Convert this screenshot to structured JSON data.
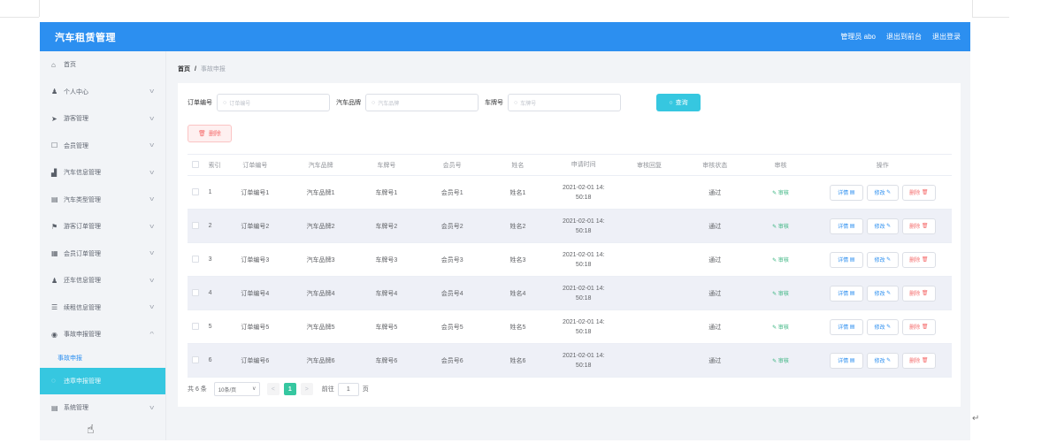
{
  "header": {
    "title": "汽车租赁管理",
    "admin": "管理员 abo",
    "back_to_front": "退出到前台",
    "logout": "退出登录"
  },
  "sidebar": {
    "items": [
      {
        "label": "首页",
        "icon": "home-icon",
        "arrow": false
      },
      {
        "label": "个人中心",
        "icon": "user-icon",
        "arrow": true
      },
      {
        "label": "游客管理",
        "icon": "send-icon",
        "arrow": true
      },
      {
        "label": "会员管理",
        "icon": "inbox-icon",
        "arrow": true
      },
      {
        "label": "汽车信息管理",
        "icon": "chart-icon",
        "arrow": true
      },
      {
        "label": "汽车类型管理",
        "icon": "list-icon",
        "arrow": true
      },
      {
        "label": "游客订单管理",
        "icon": "flag-icon",
        "arrow": true
      },
      {
        "label": "会员订单管理",
        "icon": "document-icon",
        "arrow": true
      },
      {
        "label": "还车信息管理",
        "icon": "user-icon",
        "arrow": true
      },
      {
        "label": "续租信息管理",
        "icon": "menu-icon",
        "arrow": true
      },
      {
        "label": "事故申报管理",
        "icon": "location-icon",
        "arrow": true,
        "expanded": true
      }
    ],
    "sub_item": "事故申报",
    "active_item": "违章申报管理",
    "system_item": "系统管理"
  },
  "breadcrumb": {
    "home": "首页",
    "separator": "/",
    "current": "事故申报"
  },
  "search": {
    "order_label": "订单编号",
    "order_placeholder": "订单编号",
    "brand_label": "汽车品牌",
    "brand_placeholder": "汽车品牌",
    "plate_label": "车牌号",
    "plate_placeholder": "车牌号",
    "query_button": "查询"
  },
  "delete_button": "删除",
  "table": {
    "headers": [
      "索引",
      "订单编号",
      "汽车品牌",
      "车牌号",
      "会员号",
      "姓名",
      "申请时间",
      "审核回复",
      "审核状态",
      "审核",
      "操作"
    ],
    "rows": [
      {
        "idx": "1",
        "order": "订单编号1",
        "brand": "汽车品牌1",
        "plate": "车牌号1",
        "member": "会员号1",
        "name": "姓名1",
        "time1": "2021-02-01 14:",
        "time2": "50:18",
        "reply": "",
        "status": "通过",
        "audit": "审核"
      },
      {
        "idx": "2",
        "order": "订单编号2",
        "brand": "汽车品牌2",
        "plate": "车牌号2",
        "member": "会员号2",
        "name": "姓名2",
        "time1": "2021-02-01 14:",
        "time2": "50:18",
        "reply": "",
        "status": "通过",
        "audit": "审核"
      },
      {
        "idx": "3",
        "order": "订单编号3",
        "brand": "汽车品牌3",
        "plate": "车牌号3",
        "member": "会员号3",
        "name": "姓名3",
        "time1": "2021-02-01 14:",
        "time2": "50:18",
        "reply": "",
        "status": "通过",
        "audit": "审核"
      },
      {
        "idx": "4",
        "order": "订单编号4",
        "brand": "汽车品牌4",
        "plate": "车牌号4",
        "member": "会员号4",
        "name": "姓名4",
        "time1": "2021-02-01 14:",
        "time2": "50:18",
        "reply": "",
        "status": "通过",
        "audit": "审核"
      },
      {
        "idx": "5",
        "order": "订单编号5",
        "brand": "汽车品牌5",
        "plate": "车牌号5",
        "member": "会员号5",
        "name": "姓名5",
        "time1": "2021-02-01 14:",
        "time2": "50:18",
        "reply": "",
        "status": "通过",
        "audit": "审核"
      },
      {
        "idx": "6",
        "order": "订单编号6",
        "brand": "汽车品牌6",
        "plate": "车牌号6",
        "member": "会员号6",
        "name": "姓名6",
        "time1": "2021-02-01 14:",
        "time2": "50:18",
        "reply": "",
        "status": "通过",
        "audit": "审核"
      }
    ],
    "ops": {
      "detail": "详情",
      "edit": "修改",
      "delete": "删除"
    }
  },
  "pagination": {
    "total": "共 6 条",
    "page_size": "10条/页",
    "current_page": "1",
    "goto_label": "前往",
    "goto_value": "1",
    "page_unit": "页"
  },
  "colors": {
    "header_bg": "#2c8ff0",
    "active_menu": "#36c7e0",
    "query_button": "#36c7e0",
    "delete": "#f56c6c",
    "audit_link": "#36b37e"
  }
}
